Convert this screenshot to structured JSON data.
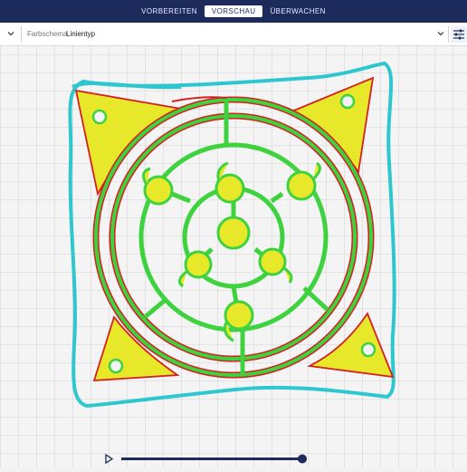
{
  "header": {
    "tabs": [
      {
        "label": "VORBEREITEN",
        "active": false
      },
      {
        "label": "VORSCHAU",
        "active": true
      },
      {
        "label": "ÜBERWACHEN",
        "active": false
      }
    ]
  },
  "toolbar": {
    "color_scheme_label": "Farbschema",
    "color_scheme_value": "Linientyp"
  },
  "playback": {
    "progress": 1.0
  },
  "colors": {
    "header_bg": "#1d2b5c",
    "skirt": "#2fc7cf",
    "infill": "#e8e82a",
    "inner_wall": "#3fd23f",
    "outer_wall": "#d42020",
    "slider": "#1d2b5c"
  },
  "icons": {
    "left_dropdown": "chevron-down-icon",
    "right_dropdown": "chevron-down-icon",
    "settings": "sliders-icon",
    "play": "play-icon"
  }
}
